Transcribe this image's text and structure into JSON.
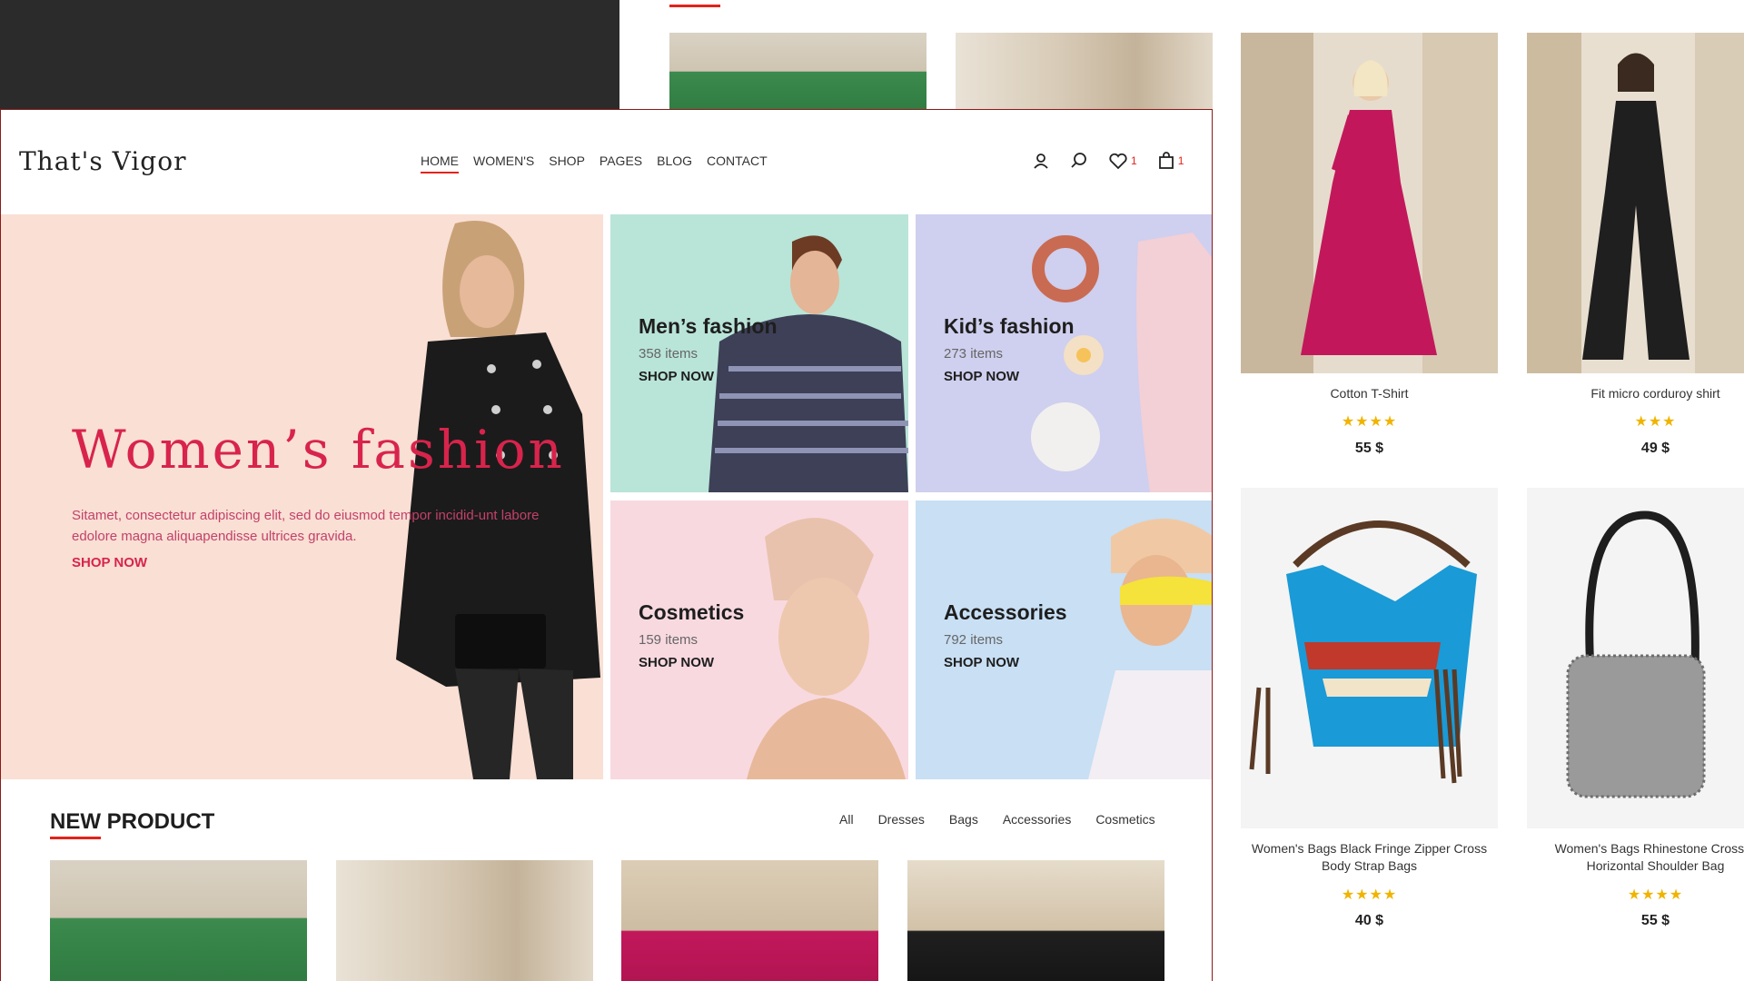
{
  "site": {
    "logo": "That's Vigor"
  },
  "nav": {
    "items": [
      {
        "label": "HOME",
        "active": true
      },
      {
        "label": "WOMEN'S",
        "active": false
      },
      {
        "label": "SHOP",
        "active": false
      },
      {
        "label": "PAGES",
        "active": false
      },
      {
        "label": "BLOG",
        "active": false
      },
      {
        "label": "CONTACT",
        "active": false
      }
    ]
  },
  "header_tools": {
    "wishlist_count": "1",
    "cart_count": "1"
  },
  "hero": {
    "title": "Women’s fashion",
    "description": "Sitamet, consectetur adipiscing elit, sed do eiusmod tempor incidid-unt labore edolore magna aliquapendisse ultrices gravida.",
    "cta": "SHOP NOW"
  },
  "categories": [
    {
      "title": "Men’s fashion",
      "count": "358 items",
      "cta": "SHOP NOW",
      "bg": "#b9e4d8"
    },
    {
      "title": "Kid’s fashion",
      "count": "273 items",
      "cta": "SHOP NOW",
      "bg": "#cfcfef"
    },
    {
      "title": "Cosmetics",
      "count": "159 items",
      "cta": "SHOP NOW",
      "bg": "#f8d9e0"
    },
    {
      "title": "Accessories",
      "count": "792 items",
      "cta": "SHOP NOW",
      "bg": "#c8dff4"
    }
  ],
  "new_product": {
    "title": "NEW PRODUCT",
    "filters": [
      "All",
      "Dresses",
      "Bags",
      "Accessories",
      "Cosmetics"
    ]
  },
  "side_products": [
    {
      "name": "Cotton T-Shirt",
      "stars": "★★★★",
      "price": "55 $"
    },
    {
      "name": "Fit micro corduroy shirt",
      "stars": "★★★",
      "price": "49 $"
    },
    {
      "name": "Women's Bags Black Fringe Zipper Cross Body Strap Bags",
      "stars": "★★★★",
      "price": "40 $"
    },
    {
      "name": "Women's Bags Rhinestone Cross B Horizontal Shoulder Bag",
      "stars": "★★★★",
      "price": "55 $"
    }
  ],
  "colors": {
    "accent": "#e2231a",
    "hero_text": "#d8244c",
    "star": "#f0b400"
  }
}
